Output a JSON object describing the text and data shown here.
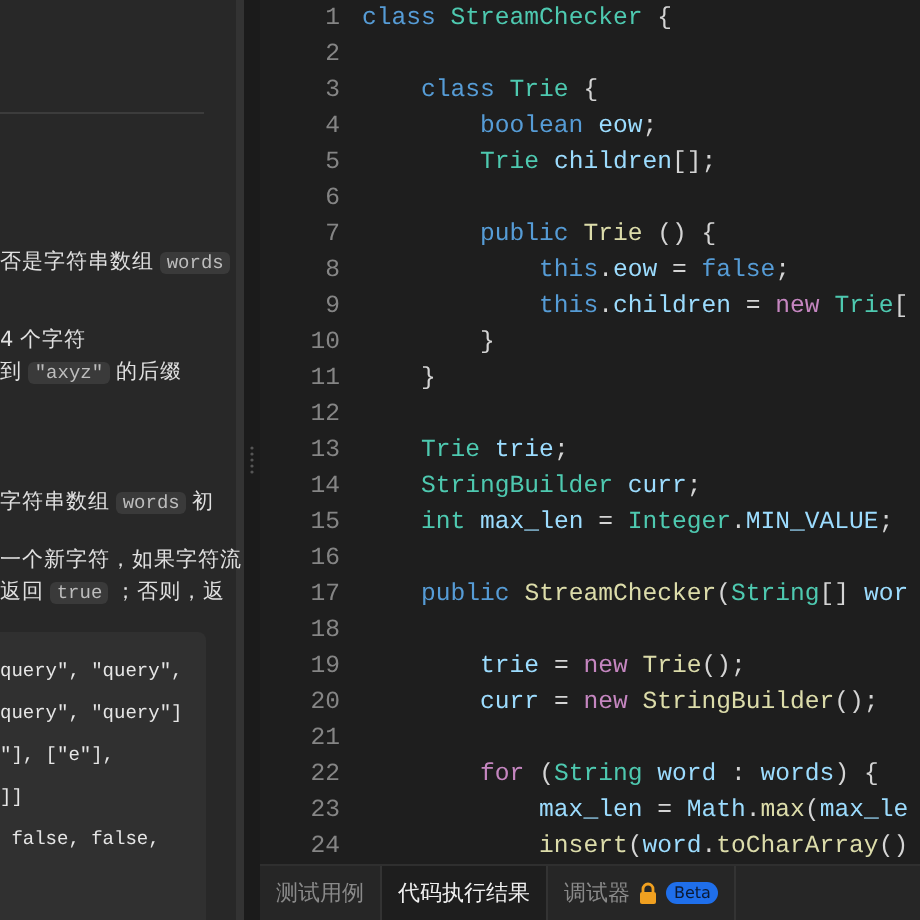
{
  "description": {
    "paragraphs": [
      [
        {
          "text": "否是字符串数组 "
        },
        {
          "code": "words"
        }
      ],
      [
        {
          "text": "4 个字符"
        }
      ],
      [
        {
          "text": "到 "
        },
        {
          "code": "\"axyz\""
        },
        {
          "text": " 的后缀"
        }
      ],
      [
        {
          "text": "字符串数组 "
        },
        {
          "code": "words"
        },
        {
          "text": " 初"
        }
      ],
      [
        {
          "text": "一个新字符，如果字符流"
        }
      ],
      [
        {
          "text": "返回 "
        },
        {
          "code": "true"
        },
        {
          "text": " ；否则，返"
        }
      ]
    ],
    "example_lines": [
      "query\", \"query\",",
      "query\", \"query\"]",
      "\"], [\"e\"],",
      "]]",
      " false, false,"
    ]
  },
  "editor": {
    "lines": [
      {
        "number": "1",
        "tokens": [
          {
            "t": "class ",
            "kind": "keyword"
          },
          {
            "t": "StreamChecker",
            "kind": "type"
          },
          {
            "t": " {",
            "kind": "plain"
          }
        ]
      },
      {
        "number": "2"
      },
      {
        "number": "3",
        "tokens": [
          {
            "t": "    class ",
            "kind": "keyword"
          },
          {
            "t": "Trie",
            "kind": "type"
          },
          {
            "t": " {",
            "kind": "plain"
          }
        ]
      },
      {
        "number": "4",
        "tokens": [
          {
            "t": "        boolean ",
            "kind": "keyword"
          },
          {
            "t": "eow",
            "kind": "var"
          },
          {
            "t": ";",
            "kind": "plain"
          }
        ]
      },
      {
        "number": "5",
        "tokens": [
          {
            "t": "        Trie ",
            "kind": "type"
          },
          {
            "t": "children",
            "kind": "var"
          },
          {
            "t": "[];",
            "kind": "plain"
          }
        ]
      },
      {
        "number": "6"
      },
      {
        "number": "7",
        "tokens": [
          {
            "t": "        public ",
            "kind": "keyword"
          },
          {
            "t": "Trie",
            "kind": "func"
          },
          {
            "t": " () {",
            "kind": "plain"
          }
        ]
      },
      {
        "number": "8",
        "tokens": [
          {
            "t": "            this",
            "kind": "keyword"
          },
          {
            "t": ".",
            "kind": "plain"
          },
          {
            "t": "eow",
            "kind": "var"
          },
          {
            "t": " = ",
            "kind": "plain"
          },
          {
            "t": "false",
            "kind": "keyword"
          },
          {
            "t": ";",
            "kind": "plain"
          }
        ]
      },
      {
        "number": "9",
        "tokens": [
          {
            "t": "            this",
            "kind": "keyword"
          },
          {
            "t": ".",
            "kind": "plain"
          },
          {
            "t": "children",
            "kind": "var"
          },
          {
            "t": " = ",
            "kind": "plain"
          },
          {
            "t": "new ",
            "kind": "control"
          },
          {
            "t": "Trie",
            "kind": "type"
          },
          {
            "t": "[",
            "kind": "plain"
          }
        ]
      },
      {
        "number": "10",
        "tokens": [
          {
            "t": "        }",
            "kind": "plain"
          }
        ]
      },
      {
        "number": "11",
        "tokens": [
          {
            "t": "    }",
            "kind": "plain"
          }
        ]
      },
      {
        "number": "12"
      },
      {
        "number": "13",
        "tokens": [
          {
            "t": "    Trie ",
            "kind": "type"
          },
          {
            "t": "trie",
            "kind": "var"
          },
          {
            "t": ";",
            "kind": "plain"
          }
        ]
      },
      {
        "number": "14",
        "tokens": [
          {
            "t": "    StringBuilder ",
            "kind": "type"
          },
          {
            "t": "curr",
            "kind": "var"
          },
          {
            "t": ";",
            "kind": "plain"
          }
        ]
      },
      {
        "number": "15",
        "tokens": [
          {
            "t": "    int ",
            "kind": "type"
          },
          {
            "t": "max_len",
            "kind": "var"
          },
          {
            "t": " = ",
            "kind": "plain"
          },
          {
            "t": "Integer",
            "kind": "type"
          },
          {
            "t": ".",
            "kind": "plain"
          },
          {
            "t": "MIN_VALUE",
            "kind": "var"
          },
          {
            "t": ";",
            "kind": "plain"
          }
        ]
      },
      {
        "number": "16"
      },
      {
        "number": "17",
        "tokens": [
          {
            "t": "    public ",
            "kind": "keyword"
          },
          {
            "t": "StreamChecker",
            "kind": "func"
          },
          {
            "t": "(",
            "kind": "plain"
          },
          {
            "t": "String",
            "kind": "type"
          },
          {
            "t": "[] ",
            "kind": "plain"
          },
          {
            "t": "wor",
            "kind": "var"
          }
        ]
      },
      {
        "number": "18"
      },
      {
        "number": "19",
        "tokens": [
          {
            "t": "        trie",
            "kind": "var"
          },
          {
            "t": " = ",
            "kind": "plain"
          },
          {
            "t": "new ",
            "kind": "control"
          },
          {
            "t": "Trie",
            "kind": "func"
          },
          {
            "t": "();",
            "kind": "plain"
          }
        ]
      },
      {
        "number": "20",
        "tokens": [
          {
            "t": "        curr",
            "kind": "var"
          },
          {
            "t": " = ",
            "kind": "plain"
          },
          {
            "t": "new ",
            "kind": "control"
          },
          {
            "t": "StringBuilder",
            "kind": "func"
          },
          {
            "t": "();",
            "kind": "plain"
          }
        ]
      },
      {
        "number": "21"
      },
      {
        "number": "22",
        "tokens": [
          {
            "t": "        for ",
            "kind": "control"
          },
          {
            "t": "(",
            "kind": "plain"
          },
          {
            "t": "String ",
            "kind": "type"
          },
          {
            "t": "word",
            "kind": "var"
          },
          {
            "t": " : ",
            "kind": "plain"
          },
          {
            "t": "words",
            "kind": "var"
          },
          {
            "t": ") {",
            "kind": "plain"
          }
        ]
      },
      {
        "number": "23",
        "tokens": [
          {
            "t": "            max_len",
            "kind": "var"
          },
          {
            "t": " = ",
            "kind": "plain"
          },
          {
            "t": "Math",
            "kind": "var"
          },
          {
            "t": ".",
            "kind": "plain"
          },
          {
            "t": "max",
            "kind": "func"
          },
          {
            "t": "(",
            "kind": "plain"
          },
          {
            "t": "max_le",
            "kind": "var"
          }
        ]
      },
      {
        "number": "24",
        "tokens": [
          {
            "t": "            insert",
            "kind": "func"
          },
          {
            "t": "(",
            "kind": "plain"
          },
          {
            "t": "word",
            "kind": "var"
          },
          {
            "t": ".",
            "kind": "plain"
          },
          {
            "t": "toCharArray",
            "kind": "func"
          },
          {
            "t": "()",
            "kind": "plain"
          }
        ]
      }
    ]
  },
  "bottom_tabs": [
    {
      "label": "测试用例",
      "selected": false
    },
    {
      "label": "代码执行结果",
      "selected": true
    },
    {
      "label": "调试器",
      "selected": false,
      "locked": true,
      "badge": "Beta"
    }
  ]
}
